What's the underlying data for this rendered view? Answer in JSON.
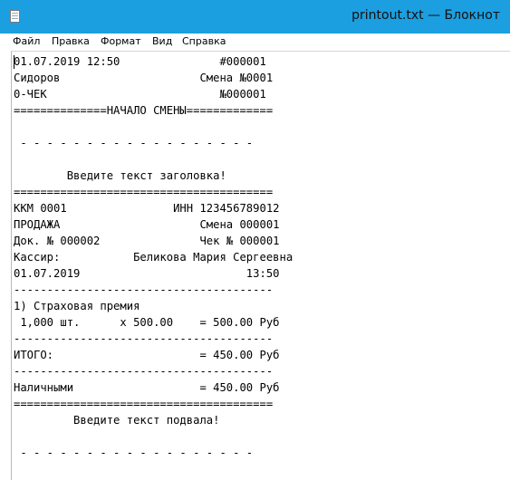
{
  "window": {
    "title": "printout.txt — Блокнот",
    "icon": "notepad-icon"
  },
  "menu": {
    "items": [
      {
        "label": "Файл"
      },
      {
        "label": "Правка"
      },
      {
        "label": "Формат"
      },
      {
        "label": "Вид"
      },
      {
        "label": "Справка"
      }
    ]
  },
  "document": {
    "lines": [
      "01.07.2019 12:50               #000001",
      "Сидоров                     Смена №0001",
      "0-ЧЕК                          №000001",
      "==============НАЧАЛО СМЕНЫ=============",
      "",
      " - - - - - - - - - - - - - - - - - -",
      "",
      "        Введите текст заголовка!",
      "=======================================",
      "ККМ 0001                ИНН 123456789012",
      "ПРОДАЖА                     Смена 000001",
      "Док. № 000002               Чек № 000001",
      "Кассир:           Беликова Мария Сергеевна",
      "01.07.2019                         13:50",
      "---------------------------------------",
      "1) Страховая премия",
      " 1,000 шт.      х 500.00    = 500.00 Руб",
      "---------------------------------------",
      "ИТОГО:                      = 450.00 Руб",
      "---------------------------------------",
      "Наличными                   = 450.00 Руб",
      "=======================================",
      "         Введите текст подвала!",
      "",
      " - - - - - - - - - - - - - - - - - -"
    ]
  }
}
